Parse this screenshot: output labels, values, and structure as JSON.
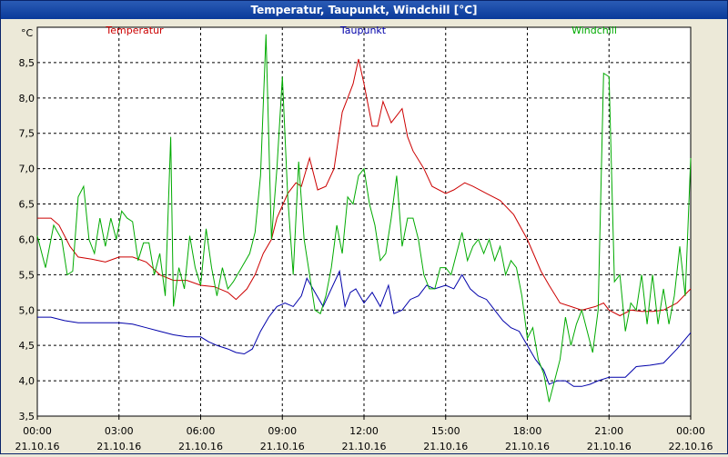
{
  "window": {
    "title": "Temperatur, Taupunkt, Windchill [°C]"
  },
  "colors": {
    "temperatur": "#cc0000",
    "taupunkt": "#0000aa",
    "windchill": "#00aa00",
    "grid": "#000000",
    "background": "#ece9d8",
    "titlebar": "#0a3a9a"
  },
  "chart_data": {
    "type": "line",
    "title": "Temperatur, Taupunkt, Windchill [°C]",
    "ylabel": "°C",
    "xlabel": "",
    "ylim": [
      3.5,
      9.0
    ],
    "xlim": [
      0,
      24
    ],
    "grid": true,
    "legend": "top",
    "y_ticks": [
      "3,5",
      "4,0",
      "4,5",
      "5,0",
      "5,5",
      "6,0",
      "6,5",
      "7,0",
      "7,5",
      "8,0",
      "8,5"
    ],
    "y_tick_values": [
      3.5,
      4.0,
      4.5,
      5.0,
      5.5,
      6.0,
      6.5,
      7.0,
      7.5,
      8.0,
      8.5
    ],
    "x_ticks": [
      {
        "hour": 0,
        "time": "00:00",
        "date": "21.10.16"
      },
      {
        "hour": 3,
        "time": "03:00",
        "date": "21.10.16"
      },
      {
        "hour": 6,
        "time": "06:00",
        "date": "21.10.16"
      },
      {
        "hour": 9,
        "time": "09:00",
        "date": "21.10.16"
      },
      {
        "hour": 12,
        "time": "12:00",
        "date": "21.10.16"
      },
      {
        "hour": 15,
        "time": "15:00",
        "date": "21.10.16"
      },
      {
        "hour": 18,
        "time": "18:00",
        "date": "21.10.16"
      },
      {
        "hour": 21,
        "time": "21:00",
        "date": "21.10.16"
      },
      {
        "hour": 24,
        "time": "00:00",
        "date": "22.10.16"
      }
    ],
    "series": [
      {
        "name": "Temperatur",
        "color": "#cc0000",
        "points": [
          [
            0,
            6.3
          ],
          [
            0.5,
            6.3
          ],
          [
            0.8,
            6.2
          ],
          [
            1.2,
            5.9
          ],
          [
            1.5,
            5.75
          ],
          [
            2,
            5.72
          ],
          [
            2.5,
            5.68
          ],
          [
            3,
            5.75
          ],
          [
            3.5,
            5.75
          ],
          [
            4,
            5.68
          ],
          [
            4.5,
            5.5
          ],
          [
            5,
            5.42
          ],
          [
            5.5,
            5.42
          ],
          [
            6,
            5.35
          ],
          [
            6.5,
            5.33
          ],
          [
            7,
            5.25
          ],
          [
            7.3,
            5.15
          ],
          [
            7.7,
            5.3
          ],
          [
            8,
            5.5
          ],
          [
            8.3,
            5.8
          ],
          [
            8.6,
            6.0
          ],
          [
            8.8,
            6.3
          ],
          [
            9.2,
            6.65
          ],
          [
            9.5,
            6.8
          ],
          [
            9.7,
            6.75
          ],
          [
            10,
            7.15
          ],
          [
            10.3,
            6.7
          ],
          [
            10.6,
            6.75
          ],
          [
            10.9,
            7.0
          ],
          [
            11.2,
            7.8
          ],
          [
            11.4,
            8.0
          ],
          [
            11.6,
            8.2
          ],
          [
            11.8,
            8.55
          ],
          [
            12,
            8.2
          ],
          [
            12.3,
            7.6
          ],
          [
            12.5,
            7.6
          ],
          [
            12.7,
            7.95
          ],
          [
            13,
            7.65
          ],
          [
            13.2,
            7.75
          ],
          [
            13.4,
            7.85
          ],
          [
            13.6,
            7.45
          ],
          [
            13.8,
            7.25
          ],
          [
            14.2,
            7.0
          ],
          [
            14.5,
            6.75
          ],
          [
            15,
            6.65
          ],
          [
            15.3,
            6.7
          ],
          [
            15.7,
            6.8
          ],
          [
            16,
            6.75
          ],
          [
            16.5,
            6.65
          ],
          [
            17,
            6.55
          ],
          [
            17.5,
            6.35
          ],
          [
            18,
            6.0
          ],
          [
            18.5,
            5.55
          ],
          [
            18.8,
            5.35
          ],
          [
            19.2,
            5.1
          ],
          [
            19.6,
            5.05
          ],
          [
            20,
            5.0
          ],
          [
            20.5,
            5.05
          ],
          [
            20.8,
            5.1
          ],
          [
            21,
            5.0
          ],
          [
            21.4,
            4.92
          ],
          [
            21.8,
            5.0
          ],
          [
            22.2,
            4.98
          ],
          [
            22.6,
            4.98
          ],
          [
            23,
            5.0
          ],
          [
            23.5,
            5.1
          ],
          [
            24,
            5.3
          ]
        ]
      },
      {
        "name": "Taupunkt",
        "color": "#0000aa",
        "points": [
          [
            0,
            4.9
          ],
          [
            0.5,
            4.9
          ],
          [
            1,
            4.85
          ],
          [
            1.5,
            4.82
          ],
          [
            2,
            4.82
          ],
          [
            2.5,
            4.82
          ],
          [
            3,
            4.82
          ],
          [
            3.5,
            4.8
          ],
          [
            4,
            4.75
          ],
          [
            4.5,
            4.7
          ],
          [
            5,
            4.65
          ],
          [
            5.5,
            4.62
          ],
          [
            6,
            4.62
          ],
          [
            6.3,
            4.55
          ],
          [
            6.6,
            4.5
          ],
          [
            7,
            4.45
          ],
          [
            7.3,
            4.4
          ],
          [
            7.6,
            4.38
          ],
          [
            7.9,
            4.45
          ],
          [
            8.2,
            4.7
          ],
          [
            8.5,
            4.9
          ],
          [
            8.8,
            5.05
          ],
          [
            9.1,
            5.1
          ],
          [
            9.4,
            5.05
          ],
          [
            9.7,
            5.2
          ],
          [
            9.9,
            5.45
          ],
          [
            10.2,
            5.25
          ],
          [
            10.5,
            5.05
          ],
          [
            10.8,
            5.3
          ],
          [
            11.1,
            5.55
          ],
          [
            11.3,
            5.05
          ],
          [
            11.5,
            5.25
          ],
          [
            11.7,
            5.3
          ],
          [
            12,
            5.1
          ],
          [
            12.3,
            5.25
          ],
          [
            12.6,
            5.05
          ],
          [
            12.9,
            5.35
          ],
          [
            13.1,
            4.95
          ],
          [
            13.4,
            5.0
          ],
          [
            13.7,
            5.15
          ],
          [
            14,
            5.2
          ],
          [
            14.3,
            5.35
          ],
          [
            14.6,
            5.3
          ],
          [
            15,
            5.35
          ],
          [
            15.3,
            5.3
          ],
          [
            15.6,
            5.5
          ],
          [
            15.9,
            5.3
          ],
          [
            16.2,
            5.2
          ],
          [
            16.5,
            5.15
          ],
          [
            16.8,
            5.0
          ],
          [
            17.1,
            4.85
          ],
          [
            17.4,
            4.75
          ],
          [
            17.7,
            4.7
          ],
          [
            18,
            4.5
          ],
          [
            18.3,
            4.3
          ],
          [
            18.6,
            4.15
          ],
          [
            18.8,
            3.95
          ],
          [
            19.1,
            4.0
          ],
          [
            19.4,
            4.0
          ],
          [
            19.7,
            3.92
          ],
          [
            20,
            3.92
          ],
          [
            20.3,
            3.95
          ],
          [
            20.6,
            4.0
          ],
          [
            21,
            4.05
          ],
          [
            21.3,
            4.05
          ],
          [
            21.6,
            4.05
          ],
          [
            22,
            4.2
          ],
          [
            22.5,
            4.22
          ],
          [
            23,
            4.25
          ],
          [
            23.5,
            4.45
          ],
          [
            24,
            4.68
          ]
        ]
      },
      {
        "name": "Windchill",
        "color": "#00aa00",
        "points": [
          [
            0,
            6.05
          ],
          [
            0.3,
            5.6
          ],
          [
            0.6,
            6.2
          ],
          [
            0.9,
            6.0
          ],
          [
            1.1,
            5.5
          ],
          [
            1.3,
            5.55
          ],
          [
            1.5,
            6.6
          ],
          [
            1.7,
            6.75
          ],
          [
            1.9,
            6.0
          ],
          [
            2.1,
            5.8
          ],
          [
            2.3,
            6.3
          ],
          [
            2.5,
            5.9
          ],
          [
            2.7,
            6.3
          ],
          [
            2.9,
            6.0
          ],
          [
            3.1,
            6.4
          ],
          [
            3.3,
            6.3
          ],
          [
            3.5,
            6.25
          ],
          [
            3.7,
            5.7
          ],
          [
            3.9,
            5.95
          ],
          [
            4.1,
            5.95
          ],
          [
            4.3,
            5.5
          ],
          [
            4.5,
            5.8
          ],
          [
            4.7,
            5.2
          ],
          [
            4.9,
            7.45
          ],
          [
            5.0,
            5.05
          ],
          [
            5.2,
            5.6
          ],
          [
            5.4,
            5.3
          ],
          [
            5.6,
            6.05
          ],
          [
            5.8,
            5.6
          ],
          [
            6.0,
            5.35
          ],
          [
            6.2,
            6.15
          ],
          [
            6.4,
            5.6
          ],
          [
            6.6,
            5.2
          ],
          [
            6.8,
            5.6
          ],
          [
            7.0,
            5.3
          ],
          [
            7.2,
            5.4
          ],
          [
            7.5,
            5.6
          ],
          [
            7.8,
            5.8
          ],
          [
            8.0,
            6.1
          ],
          [
            8.2,
            6.9
          ],
          [
            8.4,
            8.9
          ],
          [
            8.6,
            6.0
          ],
          [
            8.8,
            7.0
          ],
          [
            9.0,
            8.3
          ],
          [
            9.2,
            6.6
          ],
          [
            9.4,
            5.5
          ],
          [
            9.6,
            7.1
          ],
          [
            9.8,
            6.0
          ],
          [
            10.0,
            5.5
          ],
          [
            10.2,
            5.0
          ],
          [
            10.4,
            4.95
          ],
          [
            10.6,
            5.2
          ],
          [
            10.8,
            5.6
          ],
          [
            11.0,
            6.2
          ],
          [
            11.2,
            5.8
          ],
          [
            11.4,
            6.6
          ],
          [
            11.6,
            6.5
          ],
          [
            11.8,
            6.9
          ],
          [
            12.0,
            7.0
          ],
          [
            12.2,
            6.5
          ],
          [
            12.4,
            6.2
          ],
          [
            12.6,
            5.7
          ],
          [
            12.8,
            5.8
          ],
          [
            13.0,
            6.3
          ],
          [
            13.2,
            6.9
          ],
          [
            13.4,
            5.9
          ],
          [
            13.6,
            6.3
          ],
          [
            13.8,
            6.3
          ],
          [
            14.0,
            6.0
          ],
          [
            14.2,
            5.5
          ],
          [
            14.4,
            5.3
          ],
          [
            14.6,
            5.3
          ],
          [
            14.8,
            5.6
          ],
          [
            15.0,
            5.6
          ],
          [
            15.2,
            5.5
          ],
          [
            15.4,
            5.8
          ],
          [
            15.6,
            6.1
          ],
          [
            15.8,
            5.7
          ],
          [
            16.0,
            5.9
          ],
          [
            16.2,
            6.0
          ],
          [
            16.4,
            5.8
          ],
          [
            16.6,
            6.0
          ],
          [
            16.8,
            5.7
          ],
          [
            17.0,
            5.9
          ],
          [
            17.2,
            5.5
          ],
          [
            17.4,
            5.7
          ],
          [
            17.6,
            5.6
          ],
          [
            17.8,
            5.2
          ],
          [
            18.0,
            4.6
          ],
          [
            18.2,
            4.75
          ],
          [
            18.4,
            4.3
          ],
          [
            18.6,
            4.1
          ],
          [
            18.8,
            3.7
          ],
          [
            19.0,
            4.0
          ],
          [
            19.2,
            4.3
          ],
          [
            19.4,
            4.9
          ],
          [
            19.6,
            4.5
          ],
          [
            19.8,
            4.8
          ],
          [
            20.0,
            5.0
          ],
          [
            20.2,
            4.7
          ],
          [
            20.4,
            4.4
          ],
          [
            20.6,
            5.0
          ],
          [
            20.8,
            8.35
          ],
          [
            21.0,
            8.3
          ],
          [
            21.2,
            5.4
          ],
          [
            21.4,
            5.5
          ],
          [
            21.6,
            4.7
          ],
          [
            21.8,
            5.1
          ],
          [
            22.0,
            5.0
          ],
          [
            22.2,
            5.5
          ],
          [
            22.4,
            4.8
          ],
          [
            22.6,
            5.5
          ],
          [
            22.8,
            4.8
          ],
          [
            23.0,
            5.3
          ],
          [
            23.2,
            4.8
          ],
          [
            23.4,
            5.2
          ],
          [
            23.6,
            5.9
          ],
          [
            23.8,
            5.2
          ],
          [
            24.0,
            7.15
          ]
        ]
      }
    ]
  }
}
